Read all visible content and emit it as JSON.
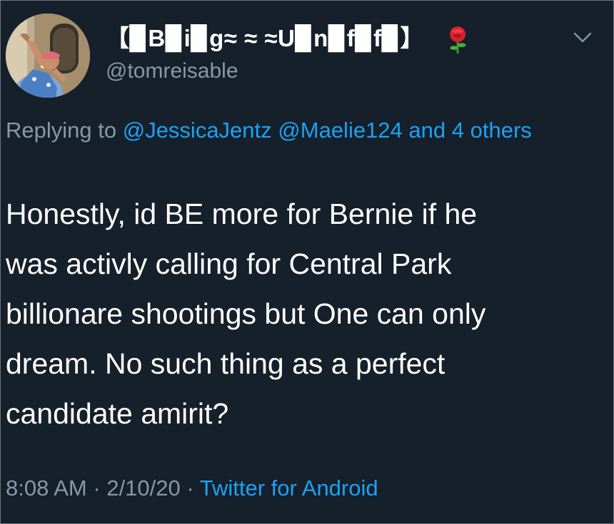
{
  "tweet": {
    "display_name": "【▉B▉i▉g≈ ≈ ≈U▉n▉f▉f▉】",
    "handle": "@tomreisable",
    "reply": {
      "prefix": "Replying to ",
      "mention_1": "@JessicaJentz",
      "mention_2": "@Maelie124",
      "others": "and 4 others"
    },
    "body_lines": [
      "Honestly, id BE more for Bernie if he",
      "was activly calling for Central Park",
      "billionare shootings but One can only",
      "dream. No such thing as a perfect",
      "candidate amirit?"
    ],
    "time": "8:08 AM",
    "date": "2/10/20",
    "separator": "·",
    "source": "Twitter for Android"
  },
  "icons": {
    "avatar": "avatar-photo",
    "emoji": "rose-emoji",
    "menu": "chevron-down-icon"
  },
  "colors": {
    "background": "#15202b",
    "text": "#ffffff",
    "secondary": "#8899a6",
    "link": "#1da1f2"
  }
}
